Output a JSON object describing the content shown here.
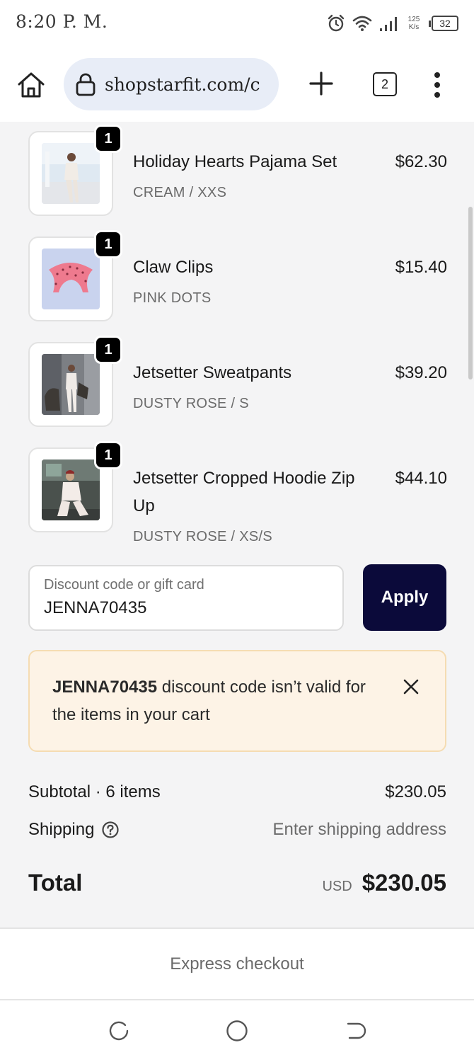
{
  "status_bar": {
    "time": "8:20 P. M.",
    "net_speed_top": "125",
    "net_speed_bottom": "K/s",
    "battery": "32"
  },
  "browser": {
    "url": "shopstarfit.com/c",
    "tab_count": "2"
  },
  "cart": {
    "items": [
      {
        "name": "Holiday Hearts Pajama Set",
        "variant": "CREAM / XXS",
        "price": "$62.30",
        "qty": "1"
      },
      {
        "name": "Claw Clips",
        "variant": "PINK DOTS",
        "price": "$15.40",
        "qty": "1"
      },
      {
        "name": "Jetsetter Sweatpants",
        "variant": "DUSTY ROSE / S",
        "price": "$39.20",
        "qty": "1"
      },
      {
        "name": "Jetsetter Cropped Hoodie Zip Up",
        "variant": "DUSTY ROSE / XS/S",
        "price": "$44.10",
        "qty": "1"
      }
    ]
  },
  "discount": {
    "placeholder": "Discount code or gift card",
    "value": "JENNA70435",
    "apply_label": "Apply"
  },
  "alert": {
    "code": "JENNA70435",
    "message": " discount code isn’t valid for the items in your cart"
  },
  "summary": {
    "subtotal_label": "Subtotal · 6 items",
    "subtotal_value": "$230.05",
    "shipping_label": "Shipping",
    "shipping_value": "Enter shipping address",
    "total_label": "Total",
    "currency": "USD",
    "total_value": "$230.05"
  },
  "express_checkout": "Express checkout"
}
